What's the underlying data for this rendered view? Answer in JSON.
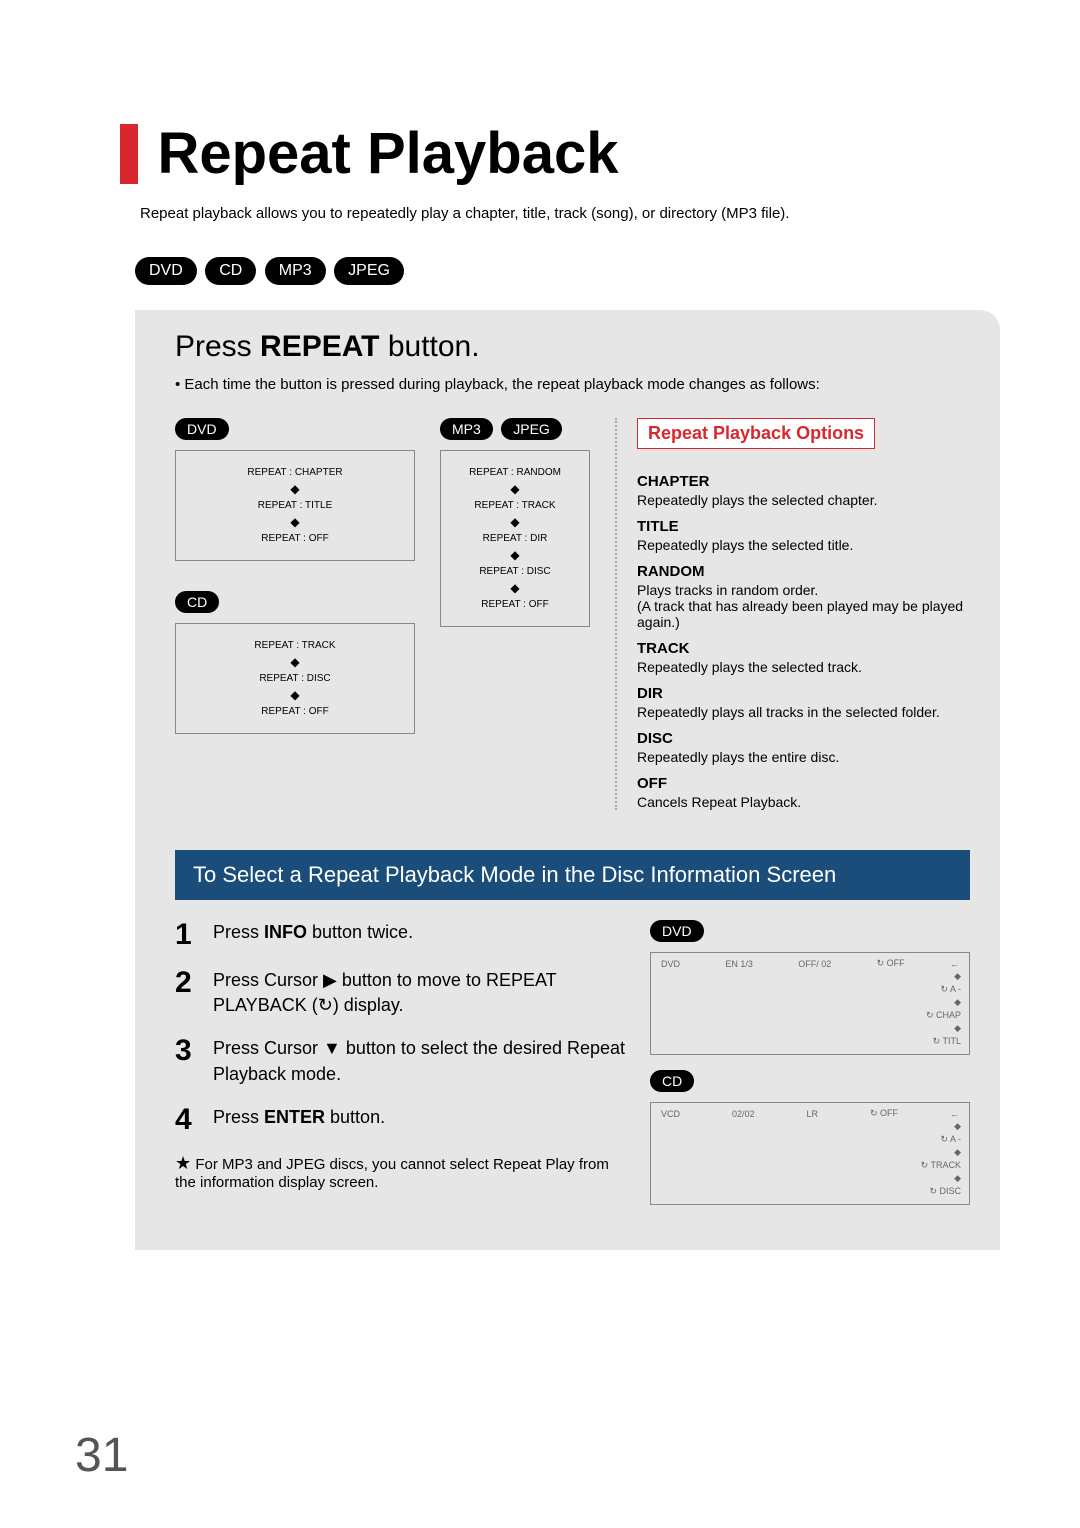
{
  "pageNumber": "31",
  "title": "Repeat Playback",
  "intro": "Repeat playback allows you to repeatedly play a chapter, title, track (song), or directory (MP3 file).",
  "media_pills": [
    "DVD",
    "CD",
    "MP3",
    "JPEG"
  ],
  "section1": {
    "heading_pre": "Press ",
    "heading_bold": "REPEAT",
    "heading_post": " button.",
    "bullet": "• Each time the button is pressed during playback, the repeat playback mode changes as follows:"
  },
  "cycles": {
    "dvd": {
      "label": "DVD",
      "items": [
        "REPEAT : CHAPTER",
        "REPEAT : TITLE",
        "REPEAT : OFF"
      ]
    },
    "mp3jpeg": {
      "labels": [
        "MP3",
        "JPEG"
      ],
      "items": [
        "REPEAT : RANDOM",
        "REPEAT : TRACK",
        "REPEAT : DIR",
        "REPEAT : DISC",
        "REPEAT : OFF"
      ]
    },
    "cd": {
      "label": "CD",
      "items": [
        "REPEAT : TRACK",
        "REPEAT : DISC",
        "REPEAT : OFF"
      ]
    }
  },
  "options": {
    "title": "Repeat Playback Options",
    "list": [
      {
        "name": "CHAPTER",
        "desc": "Repeatedly plays the selected chapter."
      },
      {
        "name": "TITLE",
        "desc": "Repeatedly plays the selected title."
      },
      {
        "name": "RANDOM",
        "desc": "Plays tracks in random order.\n(A track that has already been played may be played again.)"
      },
      {
        "name": "TRACK",
        "desc": "Repeatedly plays the selected track."
      },
      {
        "name": "DIR",
        "desc": "Repeatedly plays all tracks in the selected folder."
      },
      {
        "name": "DISC",
        "desc": "Repeatedly plays the entire disc."
      },
      {
        "name": "OFF",
        "desc": "Cancels Repeat Playback."
      }
    ]
  },
  "section2": {
    "heading": "To Select a Repeat Playback Mode in the Disc Information Screen",
    "steps": [
      "Press INFO button twice.",
      "Press Cursor ▶ button to move to REPEAT PLAYBACK ( ↻ ) display.",
      "Press Cursor ▼ button to select the desired Repeat Playback mode.",
      "Press ENTER button."
    ],
    "note": "For MP3 and JPEG discs, you cannot select Repeat Play from the information display screen."
  },
  "osd": {
    "dvd": {
      "label": "DVD",
      "bar": [
        "DVD",
        "EN 1/3",
        "OFF/ 02",
        "↻ OFF"
      ],
      "opts": [
        "↻ A -",
        "↻ CHAP",
        "↻ TITL"
      ]
    },
    "cd": {
      "label": "CD",
      "bar": [
        "VCD",
        "02/02",
        "LR",
        "↻ OFF"
      ],
      "opts": [
        "↻ A -",
        "↻ TRACK",
        "↻ DISC"
      ]
    }
  }
}
